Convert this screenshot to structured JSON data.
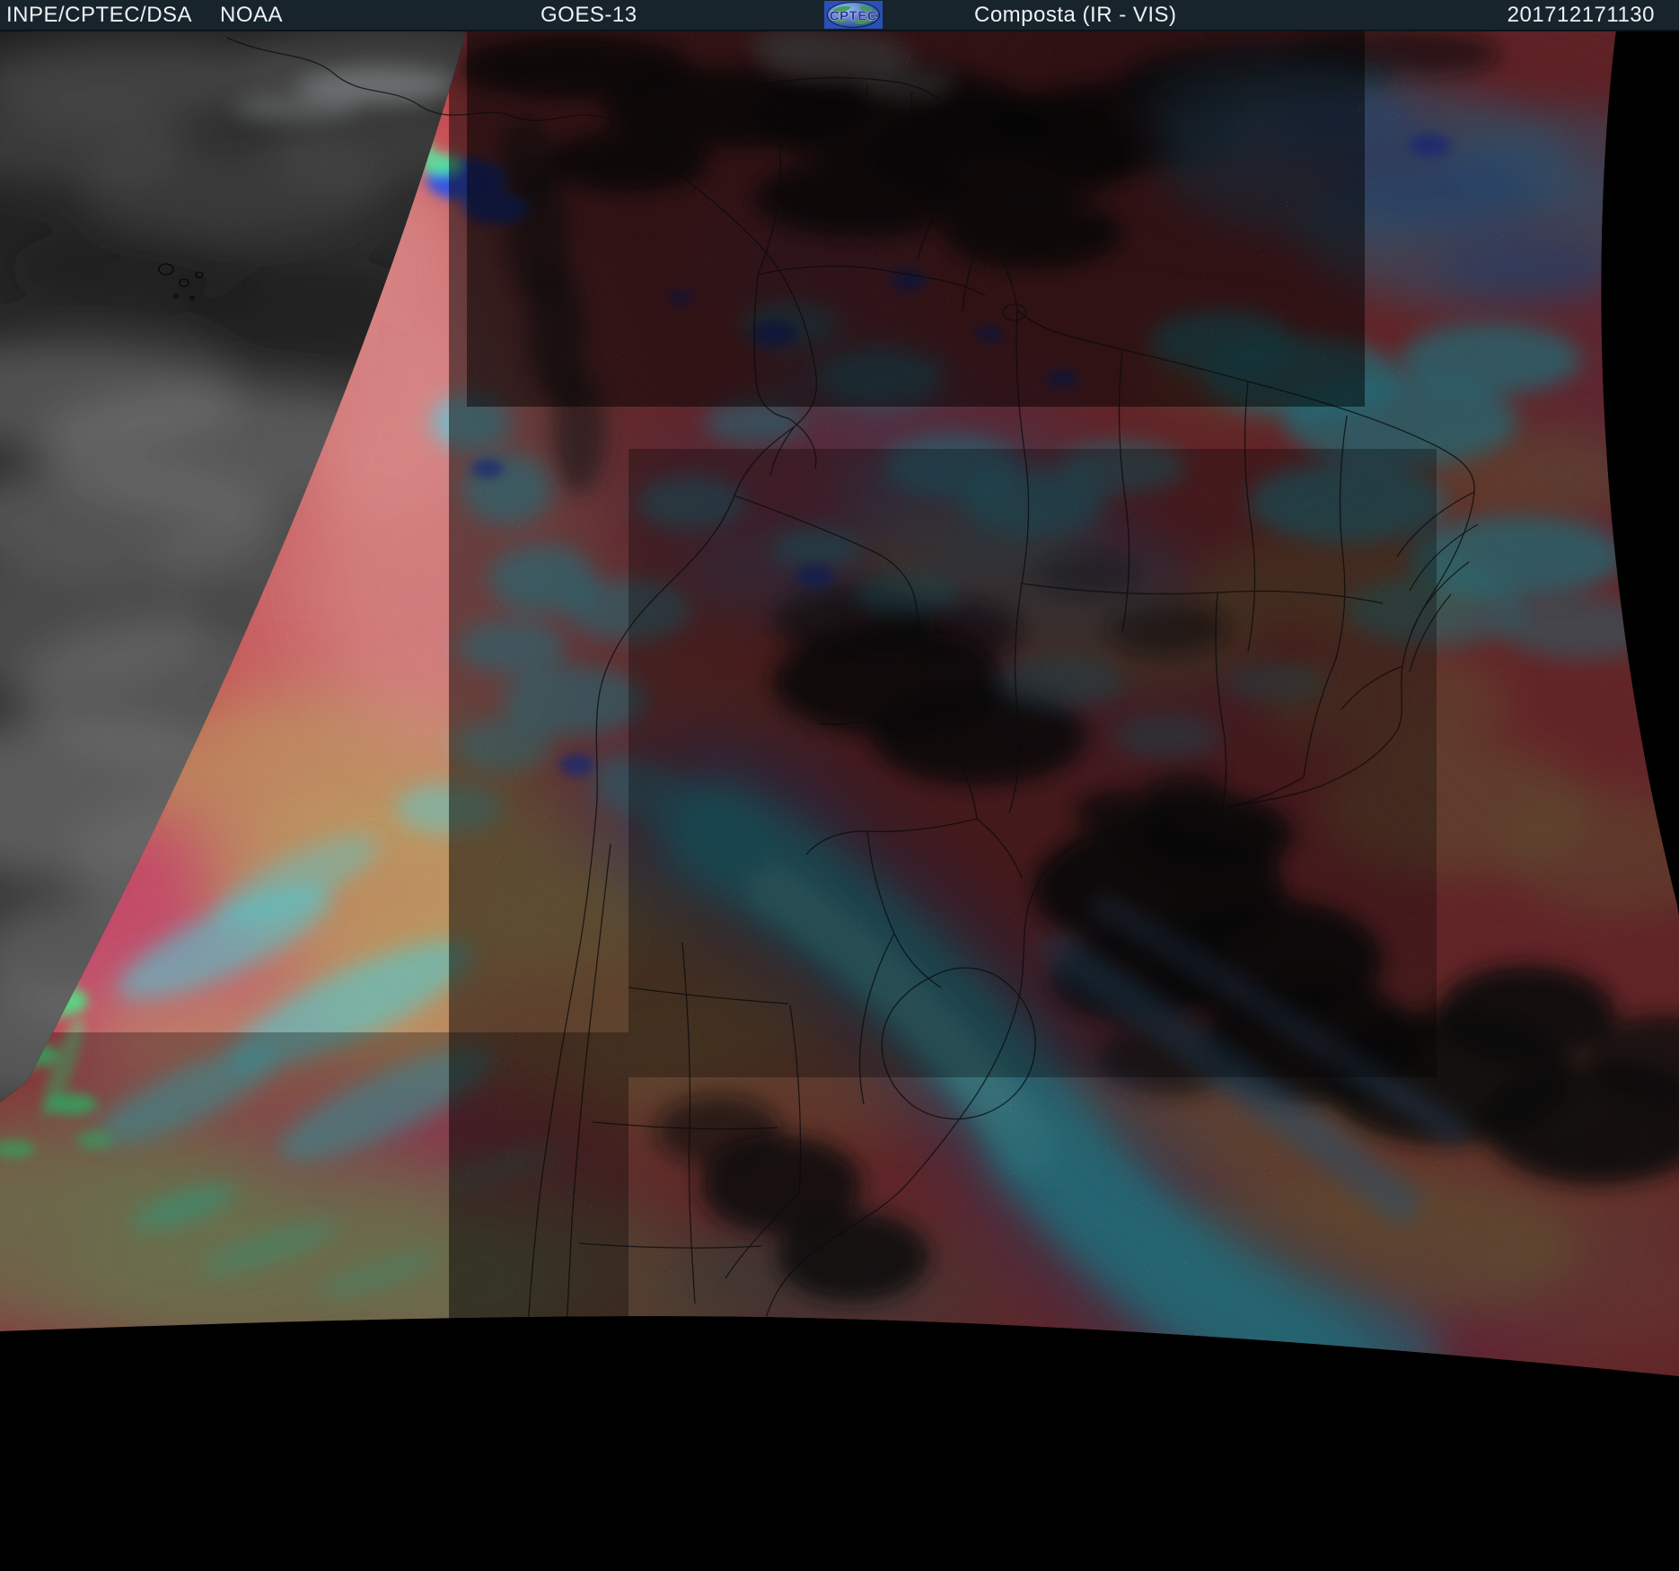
{
  "header": {
    "agency": "INPE/CPTEC/DSA",
    "noaa": "NOAA",
    "satellite": "GOES-13",
    "product": "Composta (IR - VIS)",
    "timestamp": "201712171130",
    "logo_text": "CPTEC"
  },
  "scene": {
    "palette": {
      "space": "#000000",
      "bar": "#18242c",
      "bar_text": "#edf1f3",
      "visible_gray": "#3e3e3e",
      "visible_gray_light": "#8a8a8a",
      "visible_gray_dark": "#1e1e1e",
      "base_red": "#c3494f",
      "red_dark": "#a93a44",
      "salmon": "#d0777a",
      "magenta": "#c2517c",
      "purple": "#9a5f96",
      "tan": "#b9a763",
      "khaki": "#97a06d",
      "orange": "#cf7a4e",
      "cyan_bright": "#3fd9f0",
      "cyan_core": "#7ceef8",
      "blue_soft": "#5ba6d8",
      "blue_halo": "#4878cc",
      "blue_deep": "#3352e4",
      "green_bright": "#4ae886",
      "teal_streak": "#55c8a0",
      "dark_cloud": "#191919",
      "white_cloud": "#ccd2d2",
      "border_line": "#0b0b0b",
      "logo_blue": "#1c3fae",
      "logo_green": "#3f9c46",
      "logo_letters": "#2a2f9e"
    }
  }
}
